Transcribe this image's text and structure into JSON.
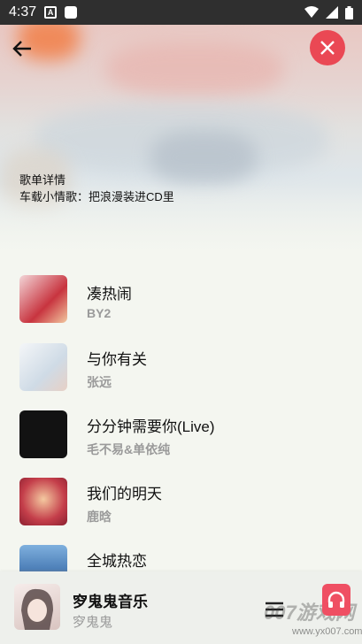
{
  "status_bar": {
    "time": "4:37",
    "notification_badge": "A"
  },
  "header": {
    "playlist_label": "歌单详情",
    "playlist_title": "车载小情歌：把浪漫装进CD里"
  },
  "songs": [
    {
      "title": "凑热闹",
      "artist": "BY2",
      "cover_color": "#c8343f"
    },
    {
      "title": "与你有关",
      "artist": "张远",
      "cover_color": "#dfe8ef"
    },
    {
      "title": "分分钟需要你(Live)",
      "artist": "毛不易&单依纯",
      "cover_color": "#121212"
    },
    {
      "title": "我们的明天",
      "artist": "鹿晗",
      "cover_color": "#c43e4a"
    },
    {
      "title": "全城热恋",
      "artist": "",
      "cover_color": "#4d7fb8"
    }
  ],
  "player": {
    "title": "穸鬼鬼音乐",
    "artist": "穸鬼鬼"
  },
  "watermark": {
    "text": "007游戏网",
    "url": "www.yx007.com"
  },
  "colors": {
    "accent": "#ea4854",
    "artist_gray": "#9a9a9a"
  }
}
